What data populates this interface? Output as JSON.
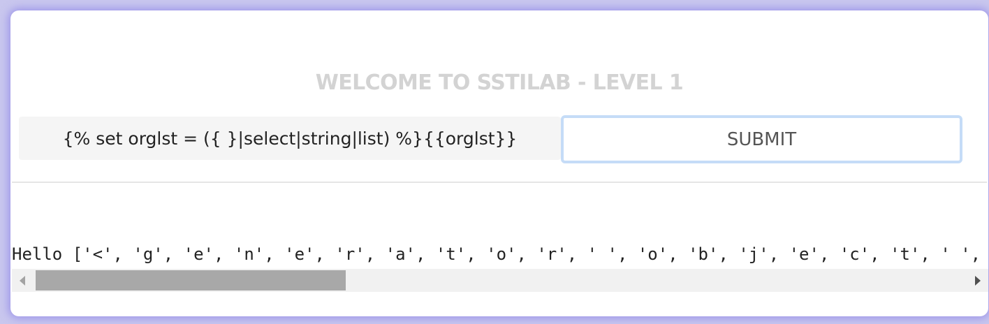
{
  "page": {
    "title": "WELCOME TO SSTILAB - LEVEL 1"
  },
  "form": {
    "payload_value": "{% set orglst = ({ }|select|string|list) %}{{orglst}}",
    "submit_label": "SUBMIT"
  },
  "output": {
    "text": "Hello ['<', 'g', 'e', 'n', 'e', 'r', 'a', 't', 'o', 'r', ' ', 'o', 'b', 'j', 'e', 'c', 't', ' ', 's', 'e', 'l', 'e', 'c', 't', '>']"
  },
  "scrollbar": {
    "position_fraction": 0.0,
    "visible_fraction": 0.32
  },
  "icons": {
    "scroll_left": "arrow-left-icon",
    "scroll_right": "arrow-right-icon"
  },
  "colors": {
    "accent_border": "#c5dcf7",
    "title_text": "#d3d3d3",
    "frame_glow": "#7f74ea"
  }
}
